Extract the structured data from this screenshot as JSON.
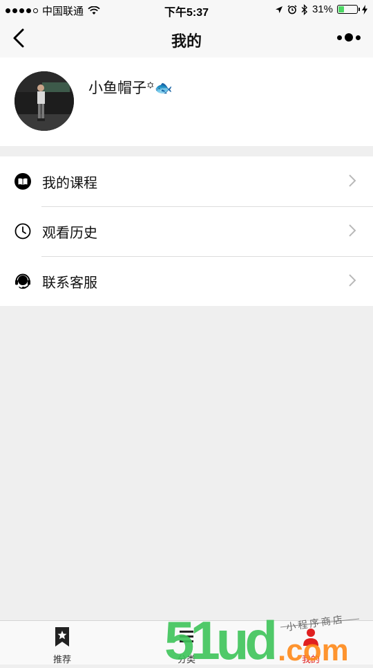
{
  "status_bar": {
    "carrier": "中国联通",
    "time": "下午5:37",
    "battery": "31%",
    "battery_level": 0.31
  },
  "nav": {
    "title": "我的"
  },
  "profile": {
    "name": "小鱼帽子꙳🐟"
  },
  "menu": [
    {
      "label": "我的课程",
      "icon": "book-icon"
    },
    {
      "label": "观看历史",
      "icon": "clock-icon"
    },
    {
      "label": "联系客服",
      "icon": "headset-icon"
    }
  ],
  "tabs": [
    {
      "label": "推荐",
      "icon": "bookmark-star-icon"
    },
    {
      "label": "分类",
      "icon": "category-icon"
    },
    {
      "label": "我的",
      "icon": "profile-icon",
      "active": true
    }
  ],
  "watermark": {
    "brand": "51ud.com",
    "subtitle": "小程序商店"
  },
  "colors": {
    "accent": "#e02020",
    "battery": "#4cd964",
    "watermark_green": "#3ec45a",
    "watermark_orange": "#ff8a1a"
  }
}
